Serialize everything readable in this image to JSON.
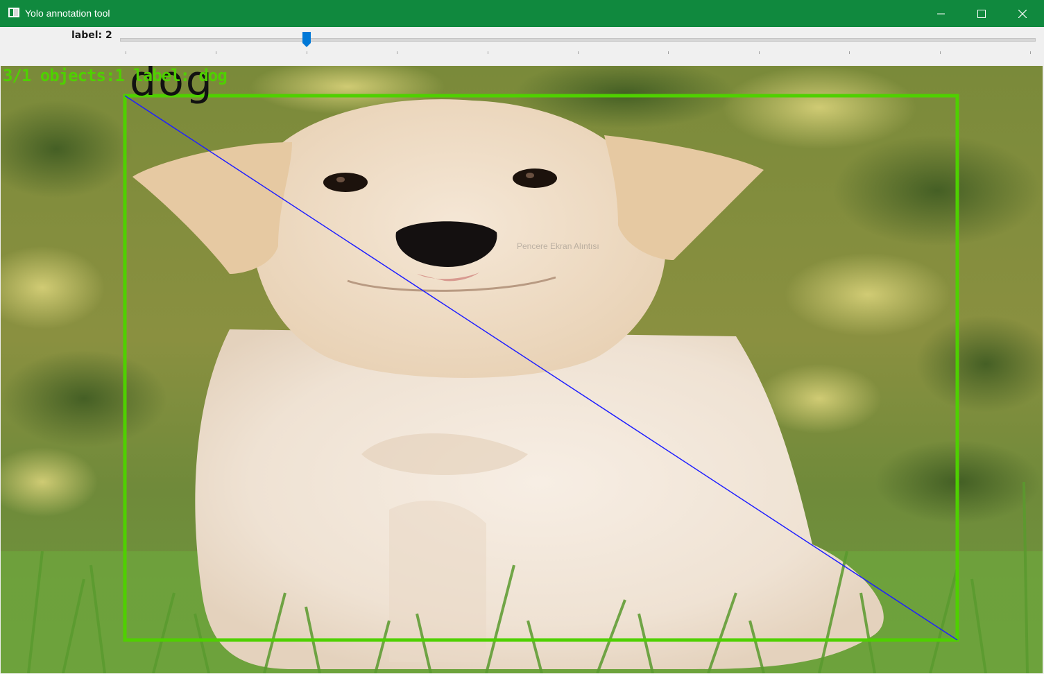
{
  "window": {
    "title": "Yolo annotation tool",
    "titlebar_color": "#10893e",
    "controls": [
      "minimize-icon",
      "maximize-icon",
      "close-icon"
    ]
  },
  "toolbar": {
    "label_text": "label: 2",
    "slider": {
      "value": 2,
      "min": 0,
      "max": 10,
      "tick_count": 11,
      "accent": "#0078d7"
    }
  },
  "annotation": {
    "status": "3/1 objects:1 label: dog",
    "box_label": "dog",
    "box_color": "#4fd000",
    "diagonal_color": "#2020ff",
    "watermark": "Pencere Ekran Alıntısı"
  }
}
